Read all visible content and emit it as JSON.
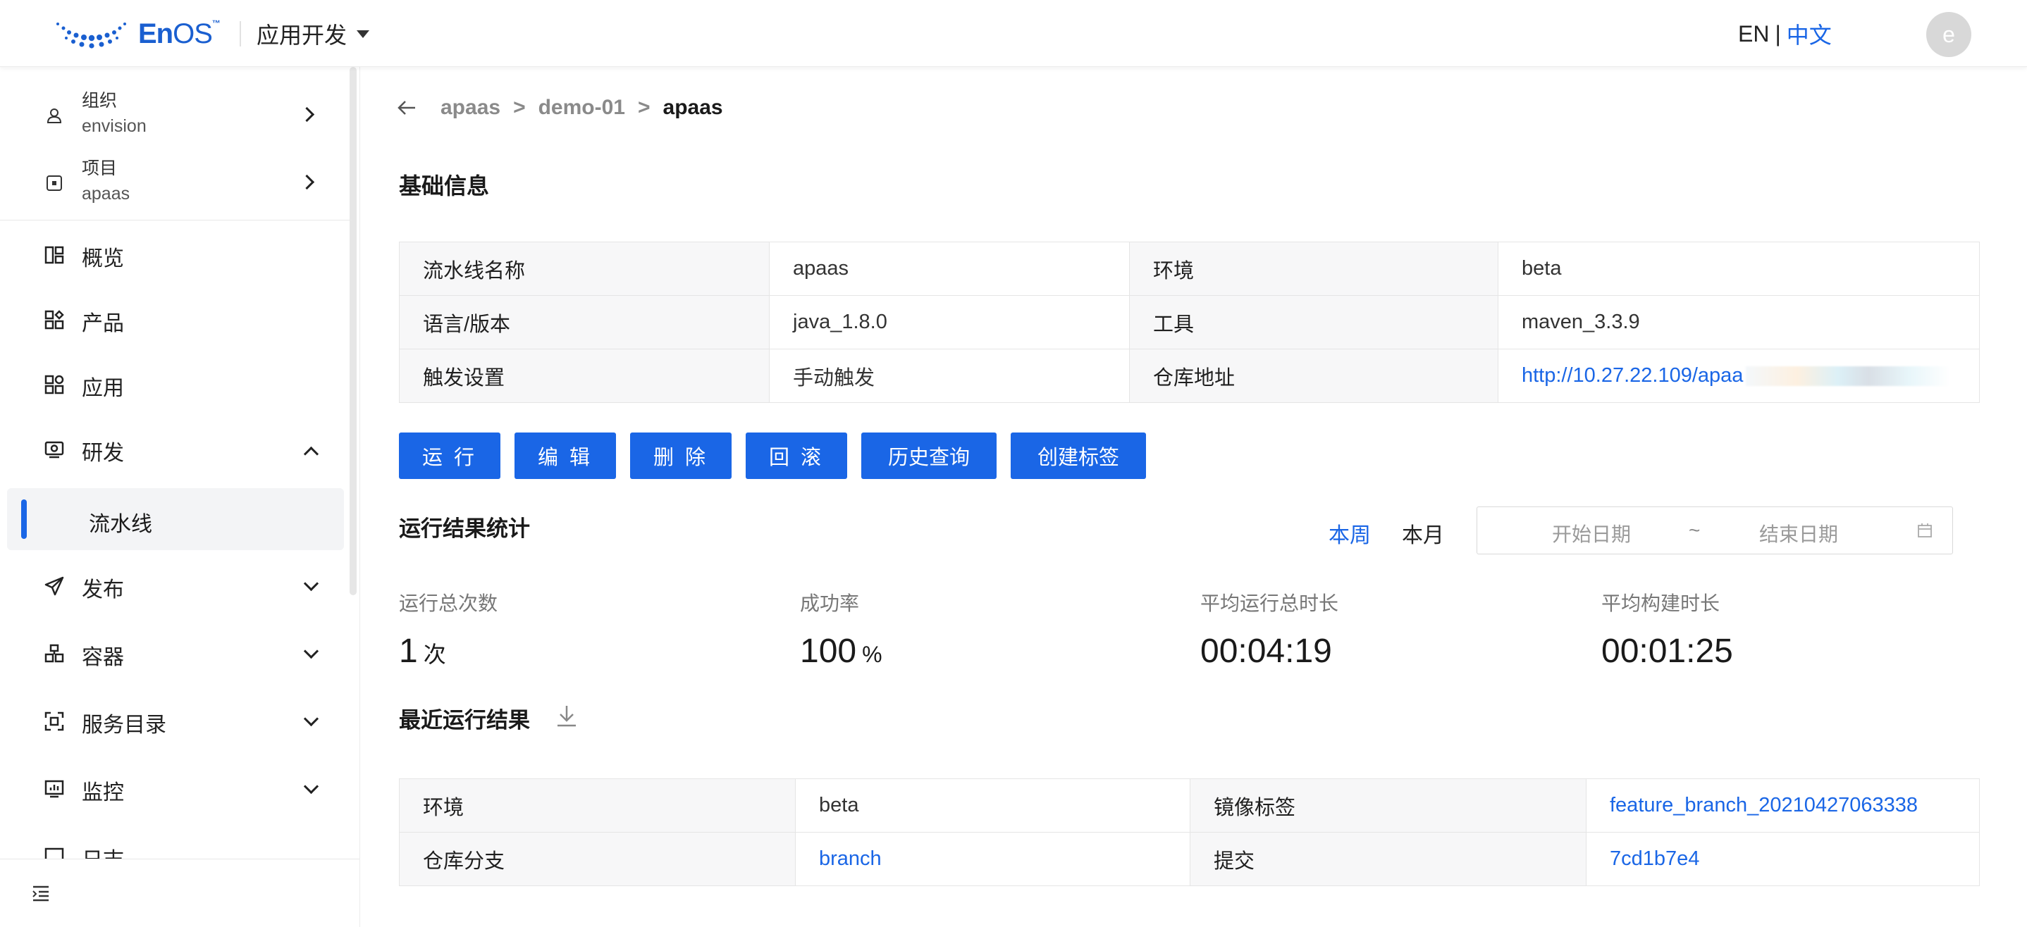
{
  "header": {
    "logo_text_en": "En",
    "logo_text_os": "OS",
    "logo_tm": "™",
    "app_switch_label": "应用开发",
    "lang_en": "EN",
    "lang_sep": "|",
    "lang_zh": "中文",
    "avatar_letter": "e"
  },
  "sidebar": {
    "org": {
      "label": "组织",
      "value": "envision"
    },
    "project": {
      "label": "项目",
      "value": "apaas"
    },
    "items": [
      {
        "label": "概览",
        "icon": "overview-icon"
      },
      {
        "label": "产品",
        "icon": "product-icon"
      },
      {
        "label": "应用",
        "icon": "application-icon"
      },
      {
        "label": "研发",
        "icon": "develop-icon",
        "expanded": true
      },
      {
        "label": "发布",
        "icon": "publish-icon"
      },
      {
        "label": "容器",
        "icon": "container-icon"
      },
      {
        "label": "服务目录",
        "icon": "service-catalog-icon"
      },
      {
        "label": "监控",
        "icon": "monitor-icon"
      },
      {
        "label": "日志",
        "icon": "log-icon"
      }
    ],
    "sub_items": [
      {
        "label": "流水线",
        "active": true
      }
    ]
  },
  "breadcrumb": [
    "apaas",
    "demo-01",
    "apaas"
  ],
  "basic_info": {
    "title": "基础信息",
    "rows": [
      [
        {
          "k": "流水线名称",
          "v": "apaas"
        },
        {
          "k": "环境",
          "v": "beta"
        }
      ],
      [
        {
          "k": "语言/版本",
          "v": "java_1.8.0"
        },
        {
          "k": "工具",
          "v": "maven_3.3.9"
        }
      ],
      [
        {
          "k": "触发设置",
          "v": "手动触发"
        },
        {
          "k": "仓库地址",
          "v": "http://10.27.22.109/apaa"
        }
      ]
    ]
  },
  "actions": [
    "运 行",
    "编 辑",
    "删 除",
    "回 滚",
    "历史查询",
    "创建标签"
  ],
  "stats": {
    "title": "运行结果统计",
    "period_week": "本周",
    "period_month": "本月",
    "start_placeholder": "开始日期",
    "range_sep": "~",
    "end_placeholder": "结束日期",
    "items": [
      {
        "label": "运行总次数",
        "value": "1",
        "unit": "次"
      },
      {
        "label": "成功率",
        "value": "100",
        "unit": "%"
      },
      {
        "label": "平均运行总时长",
        "value": "00:04:19",
        "unit": ""
      },
      {
        "label": "平均构建时长",
        "value": "00:01:25",
        "unit": ""
      }
    ]
  },
  "recent": {
    "title": "最近运行结果",
    "rows": [
      [
        {
          "k": "环境",
          "v": "beta",
          "link": false
        },
        {
          "k": "镜像标签",
          "v": "feature_branch_20210427063338",
          "link": true
        }
      ],
      [
        {
          "k": "仓库分支",
          "v": "branch",
          "link": true
        },
        {
          "k": "提交",
          "v": "7cd1b7e4",
          "link": true
        }
      ]
    ]
  },
  "colors": {
    "primary": "#1a66e6",
    "brand": "#1a5fd0"
  }
}
